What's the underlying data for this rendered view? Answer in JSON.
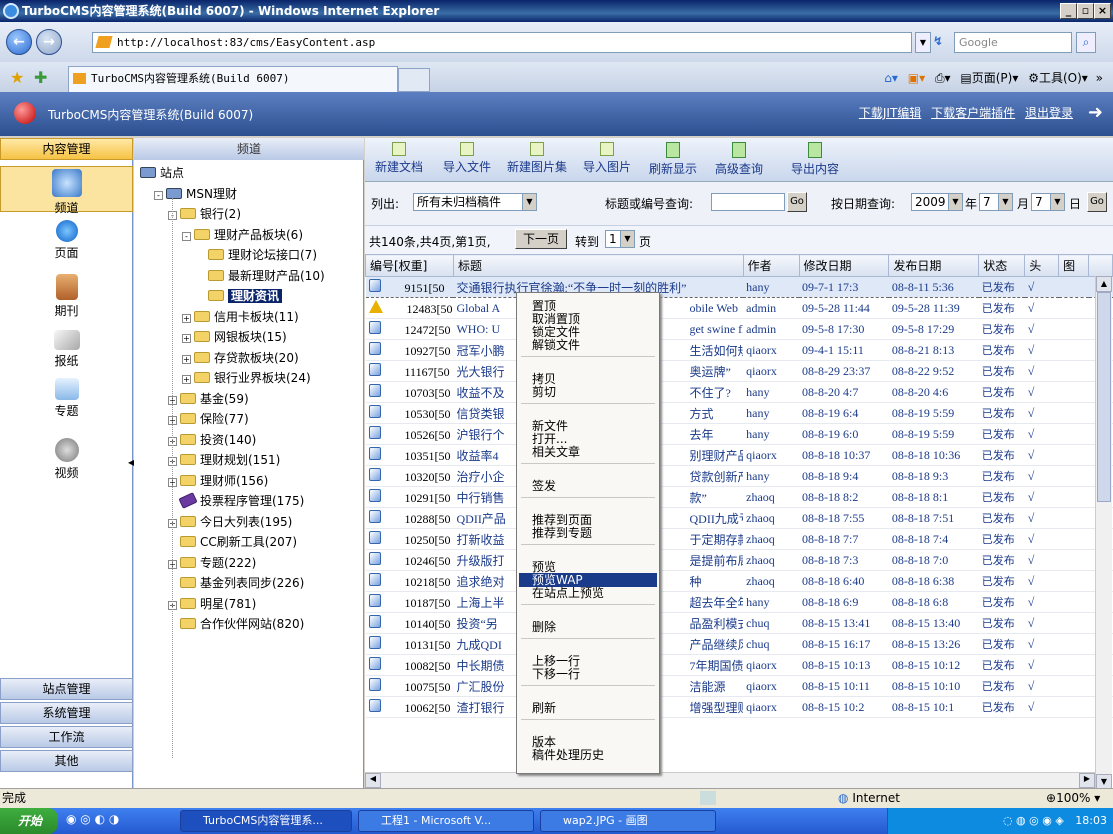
{
  "window": {
    "title": "TurboCMS内容管理系统(Build 6007) - Windows Internet Explorer"
  },
  "browser": {
    "address": "http://localhost:83/cms/EasyContent.asp",
    "search_placeholder": "Google",
    "tab_title": "TurboCMS内容管理系统(Build 6007)",
    "cmd_page": "页面(P)",
    "cmd_tools": "工具(O)"
  },
  "app": {
    "title": "TurboCMS内容管理系统(Build 6007)",
    "links": [
      "下载JIT编辑",
      "下载客户端插件",
      "退出登录"
    ]
  },
  "leftnav": {
    "header": "内容管理",
    "items": [
      "频道",
      "页面",
      "期刊",
      "报纸",
      "专题",
      "视频"
    ],
    "bottom": [
      "站点管理",
      "系统管理",
      "工作流",
      "其他"
    ]
  },
  "tree": {
    "header": "频道",
    "nodes": [
      {
        "label": "站点",
        "indent": 0,
        "pm": ""
      },
      {
        "label": "MSN理财",
        "indent": 1,
        "pm": "-"
      },
      {
        "label": "银行(2)",
        "indent": 2,
        "pm": "-"
      },
      {
        "label": "理财产品板块(6)",
        "indent": 3,
        "pm": "-"
      },
      {
        "label": "理财论坛接口(7)",
        "indent": 4,
        "pm": ""
      },
      {
        "label": "最新理财产品(10)",
        "indent": 4,
        "pm": ""
      },
      {
        "label": "理财资讯",
        "indent": 4,
        "pm": "",
        "selected": true
      },
      {
        "label": "信用卡板块(11)",
        "indent": 3,
        "pm": "+"
      },
      {
        "label": "网银板块(15)",
        "indent": 3,
        "pm": "+"
      },
      {
        "label": "存贷款板块(20)",
        "indent": 3,
        "pm": "+"
      },
      {
        "label": "银行业界板块(24)",
        "indent": 3,
        "pm": "+"
      },
      {
        "label": "基金(59)",
        "indent": 2,
        "pm": "+"
      },
      {
        "label": "保险(77)",
        "indent": 2,
        "pm": "+"
      },
      {
        "label": "投资(140)",
        "indent": 2,
        "pm": "+"
      },
      {
        "label": "理财规划(151)",
        "indent": 2,
        "pm": "+"
      },
      {
        "label": "理财师(156)",
        "indent": 2,
        "pm": "+"
      },
      {
        "label": "投票程序管理(175)",
        "indent": 2,
        "pm": ""
      },
      {
        "label": "今日大列表(195)",
        "indent": 2,
        "pm": "+"
      },
      {
        "label": "CC刷新工具(207)",
        "indent": 2,
        "pm": ""
      },
      {
        "label": "专题(222)",
        "indent": 2,
        "pm": "+"
      },
      {
        "label": "基金列表同步(226)",
        "indent": 2,
        "pm": ""
      },
      {
        "label": "明星(781)",
        "indent": 2,
        "pm": "+"
      },
      {
        "label": "合作伙伴网站(820)",
        "indent": 2,
        "pm": ""
      }
    ]
  },
  "toolbar": [
    "新建文档",
    "导入文件",
    "新建图片集",
    "导入图片",
    "刷新显示",
    "高级查询",
    "导出内容"
  ],
  "filter": {
    "list_label": "列出:",
    "list_value": "所有未归档稿件",
    "search_label": "标题或编号查询:",
    "go": "Go",
    "date_label": "按日期查询:",
    "year": "2009",
    "year_unit": "年",
    "month": "7",
    "month_unit": "月",
    "day": "7",
    "day_unit": "日"
  },
  "pager": {
    "summary": "共140条,共4页,第1页,",
    "next": "下一页",
    "goto": "转到",
    "page": "1",
    "page_unit": "页"
  },
  "grid": {
    "columns": [
      "编号[权重]",
      "标题",
      "作者",
      "修改日期",
      "发布日期",
      "状态",
      "头",
      "图"
    ],
    "rows": [
      {
        "id": "9151[50",
        "title": "交通银行执行官徐瀚:“不争一时一刻的胜利”",
        "author": "hany",
        "mod": "09-7-1 17:3",
        "pub": "08-8-11 5:36",
        "status": "已发布",
        "head": "√",
        "icon": "doc"
      },
      {
        "id": "12483[50",
        "title": "Global A",
        "title2": "obile Web",
        "author": "admin",
        "mod": "09-5-28 11:44",
        "pub": "09-5-28 11:39",
        "status": "已发布",
        "head": "√",
        "icon": "warn"
      },
      {
        "id": "12472[50",
        "title": "WHO: U",
        "title2": "get swine flu",
        "author": "admin",
        "mod": "09-5-8 17:30",
        "pub": "09-5-8 17:29",
        "status": "已发布",
        "head": "√",
        "icon": "doc"
      },
      {
        "id": "10927[50",
        "title": "冠军小鹏",
        "title2": "生活如何规划",
        "author": "qiaorx",
        "mod": "09-4-1 15:11",
        "pub": "08-8-21 8:13",
        "status": "已发布",
        "head": "√",
        "icon": "doc"
      },
      {
        "id": "11167[50",
        "title": "光大银行",
        "title2": "奥运牌”",
        "author": "qiaorx",
        "mod": "08-8-29 23:37",
        "pub": "08-8-22 9:52",
        "status": "已发布",
        "head": "√",
        "icon": "doc"
      },
      {
        "id": "10703[50",
        "title": "收益不及",
        "title2": "不住了?",
        "author": "hany",
        "mod": "08-8-20 4:7",
        "pub": "08-8-20 4:6",
        "status": "已发布",
        "head": "√",
        "icon": "doc"
      },
      {
        "id": "10530[50",
        "title": "信贷类银",
        "title2": "方式",
        "author": "hany",
        "mod": "08-8-19 6:4",
        "pub": "08-8-19 5:59",
        "status": "已发布",
        "head": "√",
        "icon": "doc"
      },
      {
        "id": "10526[50",
        "title": "沪银行个",
        "title2": "去年",
        "author": "hany",
        "mod": "08-8-19 6:0",
        "pub": "08-8-19 5:59",
        "status": "已发布",
        "head": "√",
        "icon": "doc"
      },
      {
        "id": "10351[50",
        "title": "收益率4",
        "title2": "别理财产品",
        "author": "qiaorx",
        "mod": "08-8-18 10:37",
        "pub": "08-8-18 10:36",
        "status": "已发布",
        "head": "√",
        "icon": "doc"
      },
      {
        "id": "10320[50",
        "title": "治疗小企",
        "title2": "贷款创新产品",
        "author": "hany",
        "mod": "08-8-18 9:4",
        "pub": "08-8-18 9:3",
        "status": "已发布",
        "head": "√",
        "icon": "doc"
      },
      {
        "id": "10291[50",
        "title": "中行销售",
        "title2": "款”",
        "author": "zhaoq",
        "mod": "08-8-18 8:2",
        "pub": "08-8-18 8:1",
        "status": "已发布",
        "head": "√",
        "icon": "doc"
      },
      {
        "id": "10288[50",
        "title": "QDII产品",
        "title2": "QDII九成亏损",
        "author": "zhaoq",
        "mod": "08-8-18 7:55",
        "pub": "08-8-18 7:51",
        "status": "已发布",
        "head": "√",
        "icon": "doc"
      },
      {
        "id": "10250[50",
        "title": "打新收益",
        "title2": "于定期存款",
        "author": "zhaoq",
        "mod": "08-8-18 7:7",
        "pub": "08-8-18 7:4",
        "status": "已发布",
        "head": "√",
        "icon": "doc"
      },
      {
        "id": "10246[50",
        "title": "升级版打",
        "title2": "是提前布局?",
        "author": "zhaoq",
        "mod": "08-8-18 7:3",
        "pub": "08-8-18 7:0",
        "status": "已发布",
        "head": "√",
        "icon": "doc"
      },
      {
        "id": "10218[50",
        "title": "追求绝对",
        "title2": "种",
        "author": "zhaoq",
        "mod": "08-8-18 6:40",
        "pub": "08-8-18 6:38",
        "status": "已发布",
        "head": "√",
        "icon": "doc"
      },
      {
        "id": "10187[50",
        "title": "上海上半",
        "title2": "超去年全年",
        "author": "hany",
        "mod": "08-8-18 6:9",
        "pub": "08-8-18 6:8",
        "status": "已发布",
        "head": "√",
        "icon": "doc"
      },
      {
        "id": "10140[50",
        "title": "投资“另",
        "title2": "品盈利模式",
        "author": "chuq",
        "mod": "08-8-15 13:41",
        "pub": "08-8-15 13:40",
        "status": "已发布",
        "head": "√",
        "icon": "doc"
      },
      {
        "id": "10131[50",
        "title": "九成QDI",
        "title2": "产品继续风靡",
        "author": "chuq",
        "mod": "08-8-15 16:17",
        "pub": "08-8-15 13:26",
        "status": "已发布",
        "head": "√",
        "icon": "doc"
      },
      {
        "id": "10082[50",
        "title": "中长期债",
        "title2": "7年期国债发行",
        "author": "qiaorx",
        "mod": "08-8-15 10:13",
        "pub": "08-8-15 10:12",
        "status": "已发布",
        "head": "√",
        "icon": "doc"
      },
      {
        "id": "10075[50",
        "title": "广汇股份",
        "title2": "洁能源",
        "author": "qiaorx",
        "mod": "08-8-15 10:11",
        "pub": "08-8-15 10:10",
        "status": "已发布",
        "head": "√",
        "icon": "doc"
      },
      {
        "id": "10062[50",
        "title": "渣打银行",
        "title2": "增强型理财产",
        "author": "qiaorx",
        "mod": "08-8-15 10:2",
        "pub": "08-8-15 10:1",
        "status": "已发布",
        "head": "√",
        "icon": "doc"
      }
    ]
  },
  "context_menu": {
    "groups": [
      [
        "置顶",
        "取消置顶",
        "锁定文件",
        "解锁文件"
      ],
      [
        "拷贝",
        "剪切"
      ],
      [
        "新文件",
        "打开...",
        "相关文章"
      ],
      [
        "签发"
      ],
      [
        "推荐到页面",
        "推荐到专题"
      ],
      [
        "预览",
        "预览WAP",
        "在站点上预览"
      ],
      [
        "删除"
      ],
      [
        "上移一行",
        "下移一行"
      ],
      [
        "刷新"
      ],
      [
        "版本",
        "稿件处理历史"
      ]
    ],
    "highlighted": "预览WAP"
  },
  "statusbar": {
    "left": "完成",
    "zone": "Internet",
    "zoom": "100%"
  },
  "taskbar": {
    "start": "开始",
    "tasks": [
      "TurboCMS内容管理系...",
      "工程1 - Microsoft V...",
      "wap2.JPG - 画图"
    ],
    "clock": "18:03"
  }
}
